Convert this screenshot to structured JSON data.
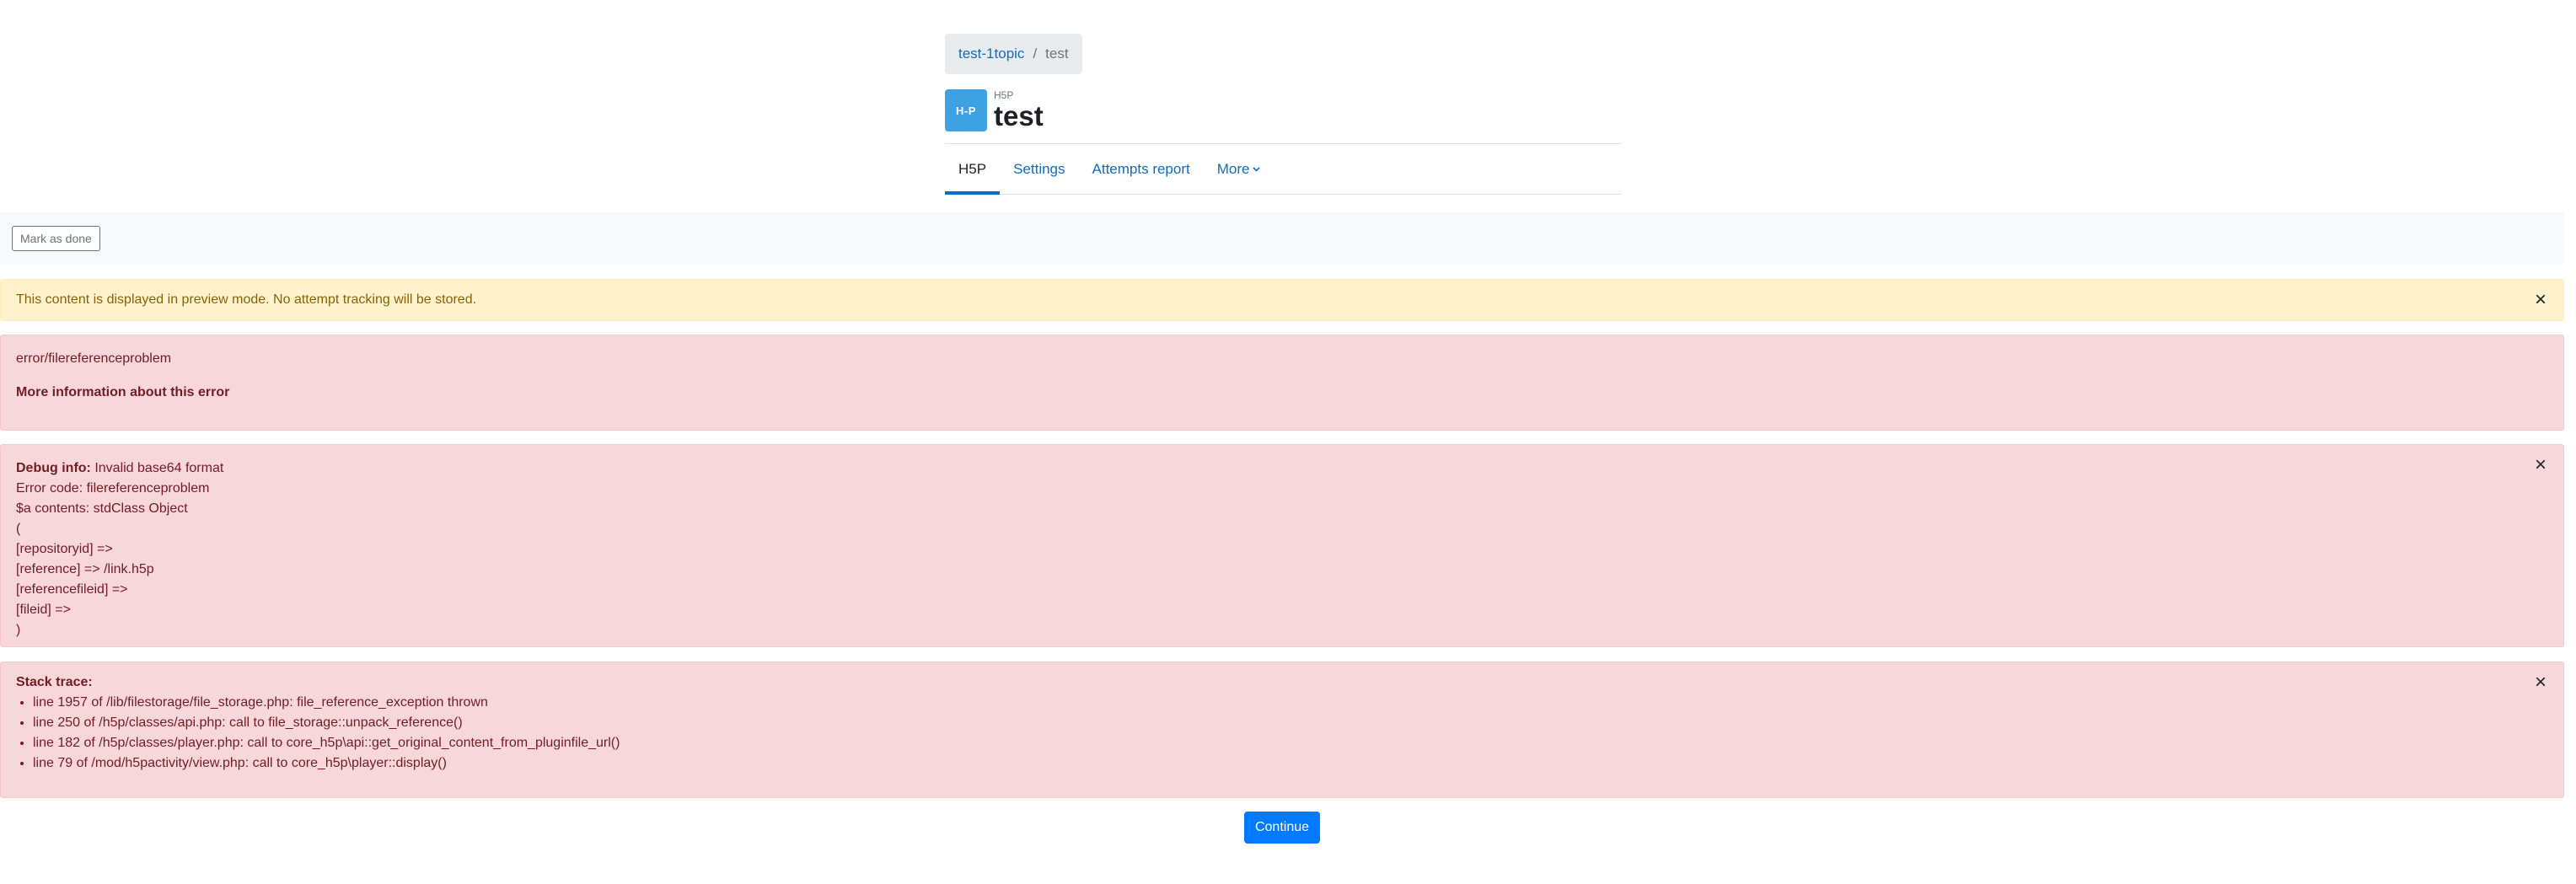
{
  "breadcrumb": {
    "course": "test-1topic",
    "separator": "/",
    "current": "test"
  },
  "header": {
    "icon_text": "H-P",
    "module_name": "H5P",
    "title": "test"
  },
  "tabs": [
    {
      "label": "H5P",
      "active": true
    },
    {
      "label": "Settings",
      "active": false
    },
    {
      "label": "Attempts report",
      "active": false
    },
    {
      "label": "More",
      "active": false
    }
  ],
  "completion": {
    "mark_done_label": "Mark as done"
  },
  "preview_alert": {
    "text": "This content is displayed in preview mode. No attempt tracking will be stored.",
    "close": "×"
  },
  "error": {
    "code_text": "error/filereferenceproblem",
    "more_info": "More information about this error"
  },
  "debug": {
    "label": "Debug info:",
    "message": " Invalid base64 format",
    "lines": [
      "Error code: filereferenceproblem",
      "$a contents: stdClass Object",
      "(",
      "[repositoryid] =>",
      "[reference] => /link.h5p",
      "[referencefileid] =>",
      "[fileid] =>",
      ")"
    ],
    "close": "×"
  },
  "stack": {
    "label": "Stack trace:",
    "items": [
      "line 1957 of /lib/filestorage/file_storage.php: file_reference_exception thrown",
      "line 250 of /h5p/classes/api.php: call to file_storage::unpack_reference()",
      "line 182 of /h5p/classes/player.php: call to core_h5p\\api::get_original_content_from_pluginfile_url()",
      "line 79 of /mod/h5pactivity/view.php: call to core_h5p\\player::display()"
    ],
    "close": "×"
  },
  "continue_label": "Continue"
}
